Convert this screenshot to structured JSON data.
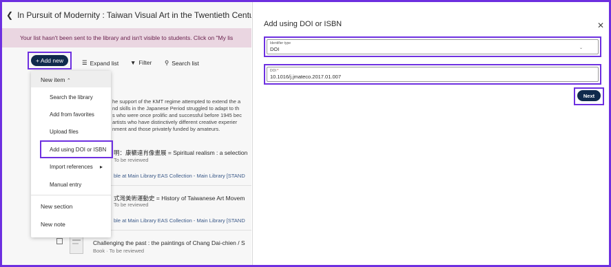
{
  "page": {
    "title": "In Pursuit of Modernity : Taiwan Visual Art in the Twentieth Century",
    "back_icon": "chevron-left-icon",
    "banner": "Your list hasn't been sent to the library and isn't visible to students. Click on \"My lis"
  },
  "toolbar": {
    "add_new": "+ Add new",
    "expand_list": "Expand list",
    "filter": "Filter",
    "search_list": "Search list"
  },
  "menu": {
    "new_item": "New item",
    "items": [
      "Search the library",
      "Add from favorites",
      "Upload files",
      "Add using DOI or ISBN",
      "Import references",
      "Manual entry"
    ],
    "new_section": "New section",
    "new_note": "New note"
  },
  "background": {
    "count": ")",
    "lines": [
      "he support of the KMT regime attempted to extend the a",
      "nd skills in the Japanese Period struggled to adapt to th",
      "s who were once prolific and successful before 1945 bec",
      "artists who have distinctively different creative experier",
      "nment and those privately funded by amateurs."
    ],
    "items": [
      {
        "title": "明：康穮達肖像畫展 = Spiritual realism : a selection",
        "status": "To be reviewed",
        "availability": "ble at Main Library EAS Collection - Main Library [STAND"
      },
      {
        "title": "式灣美術運動史 = History of Taiwanese Art Movem",
        "status": "To be reviewed",
        "availability": "ble at Main Library EAS Collection - Main Library [STAND"
      },
      {
        "title": "Challenging the past : the paintings of Chang Dai-chien / S",
        "type": "Book",
        "status": "To be reviewed"
      }
    ]
  },
  "panel": {
    "title": "Add using DOI or ISBN",
    "close_icon": "close-icon",
    "identifier_label": "Identifier type",
    "identifier_value": "DOI",
    "doi_label": "DOI",
    "doi_required": "*",
    "doi_value": "10.1016/j.jmateco.2017.01.007",
    "next": "Next"
  },
  "colors": {
    "highlight": "#6d2fe0",
    "primary_button": "#102a4c",
    "banner_bg": "#f2dde9"
  }
}
